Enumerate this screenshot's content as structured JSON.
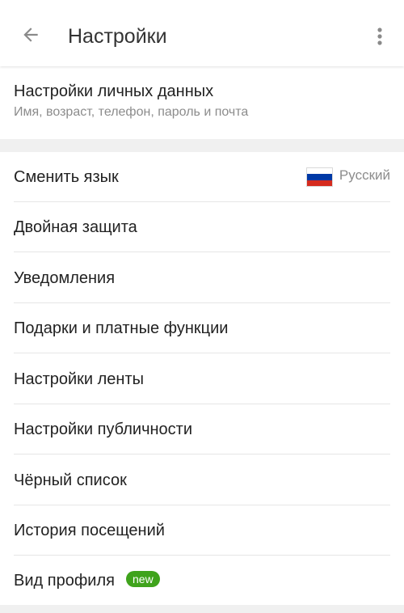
{
  "header": {
    "title": "Настройки",
    "back_icon": "arrow-left",
    "more_icon": "vertical-ellipsis"
  },
  "personal": {
    "title": "Настройки личных данных",
    "subtitle": "Имя, возраст, телефон, пароль и почта"
  },
  "language": {
    "label": "Сменить язык",
    "value": "Русский",
    "flag_colors": [
      "#ffffff",
      "#0039a6",
      "#d52b1e"
    ]
  },
  "items": [
    {
      "label": "Двойная защита"
    },
    {
      "label": "Уведомления"
    },
    {
      "label": "Подарки и платные функции"
    },
    {
      "label": "Настройки ленты"
    },
    {
      "label": "Настройки публичности"
    },
    {
      "label": "Чёрный список"
    },
    {
      "label": "История посещений"
    }
  ],
  "profile_view": {
    "label": "Вид профиля",
    "badge": "new"
  },
  "colors": {
    "badge_green": "#3fa31c",
    "section_gap": "#f0f0f0",
    "secondary_text": "#8c8c8c"
  }
}
